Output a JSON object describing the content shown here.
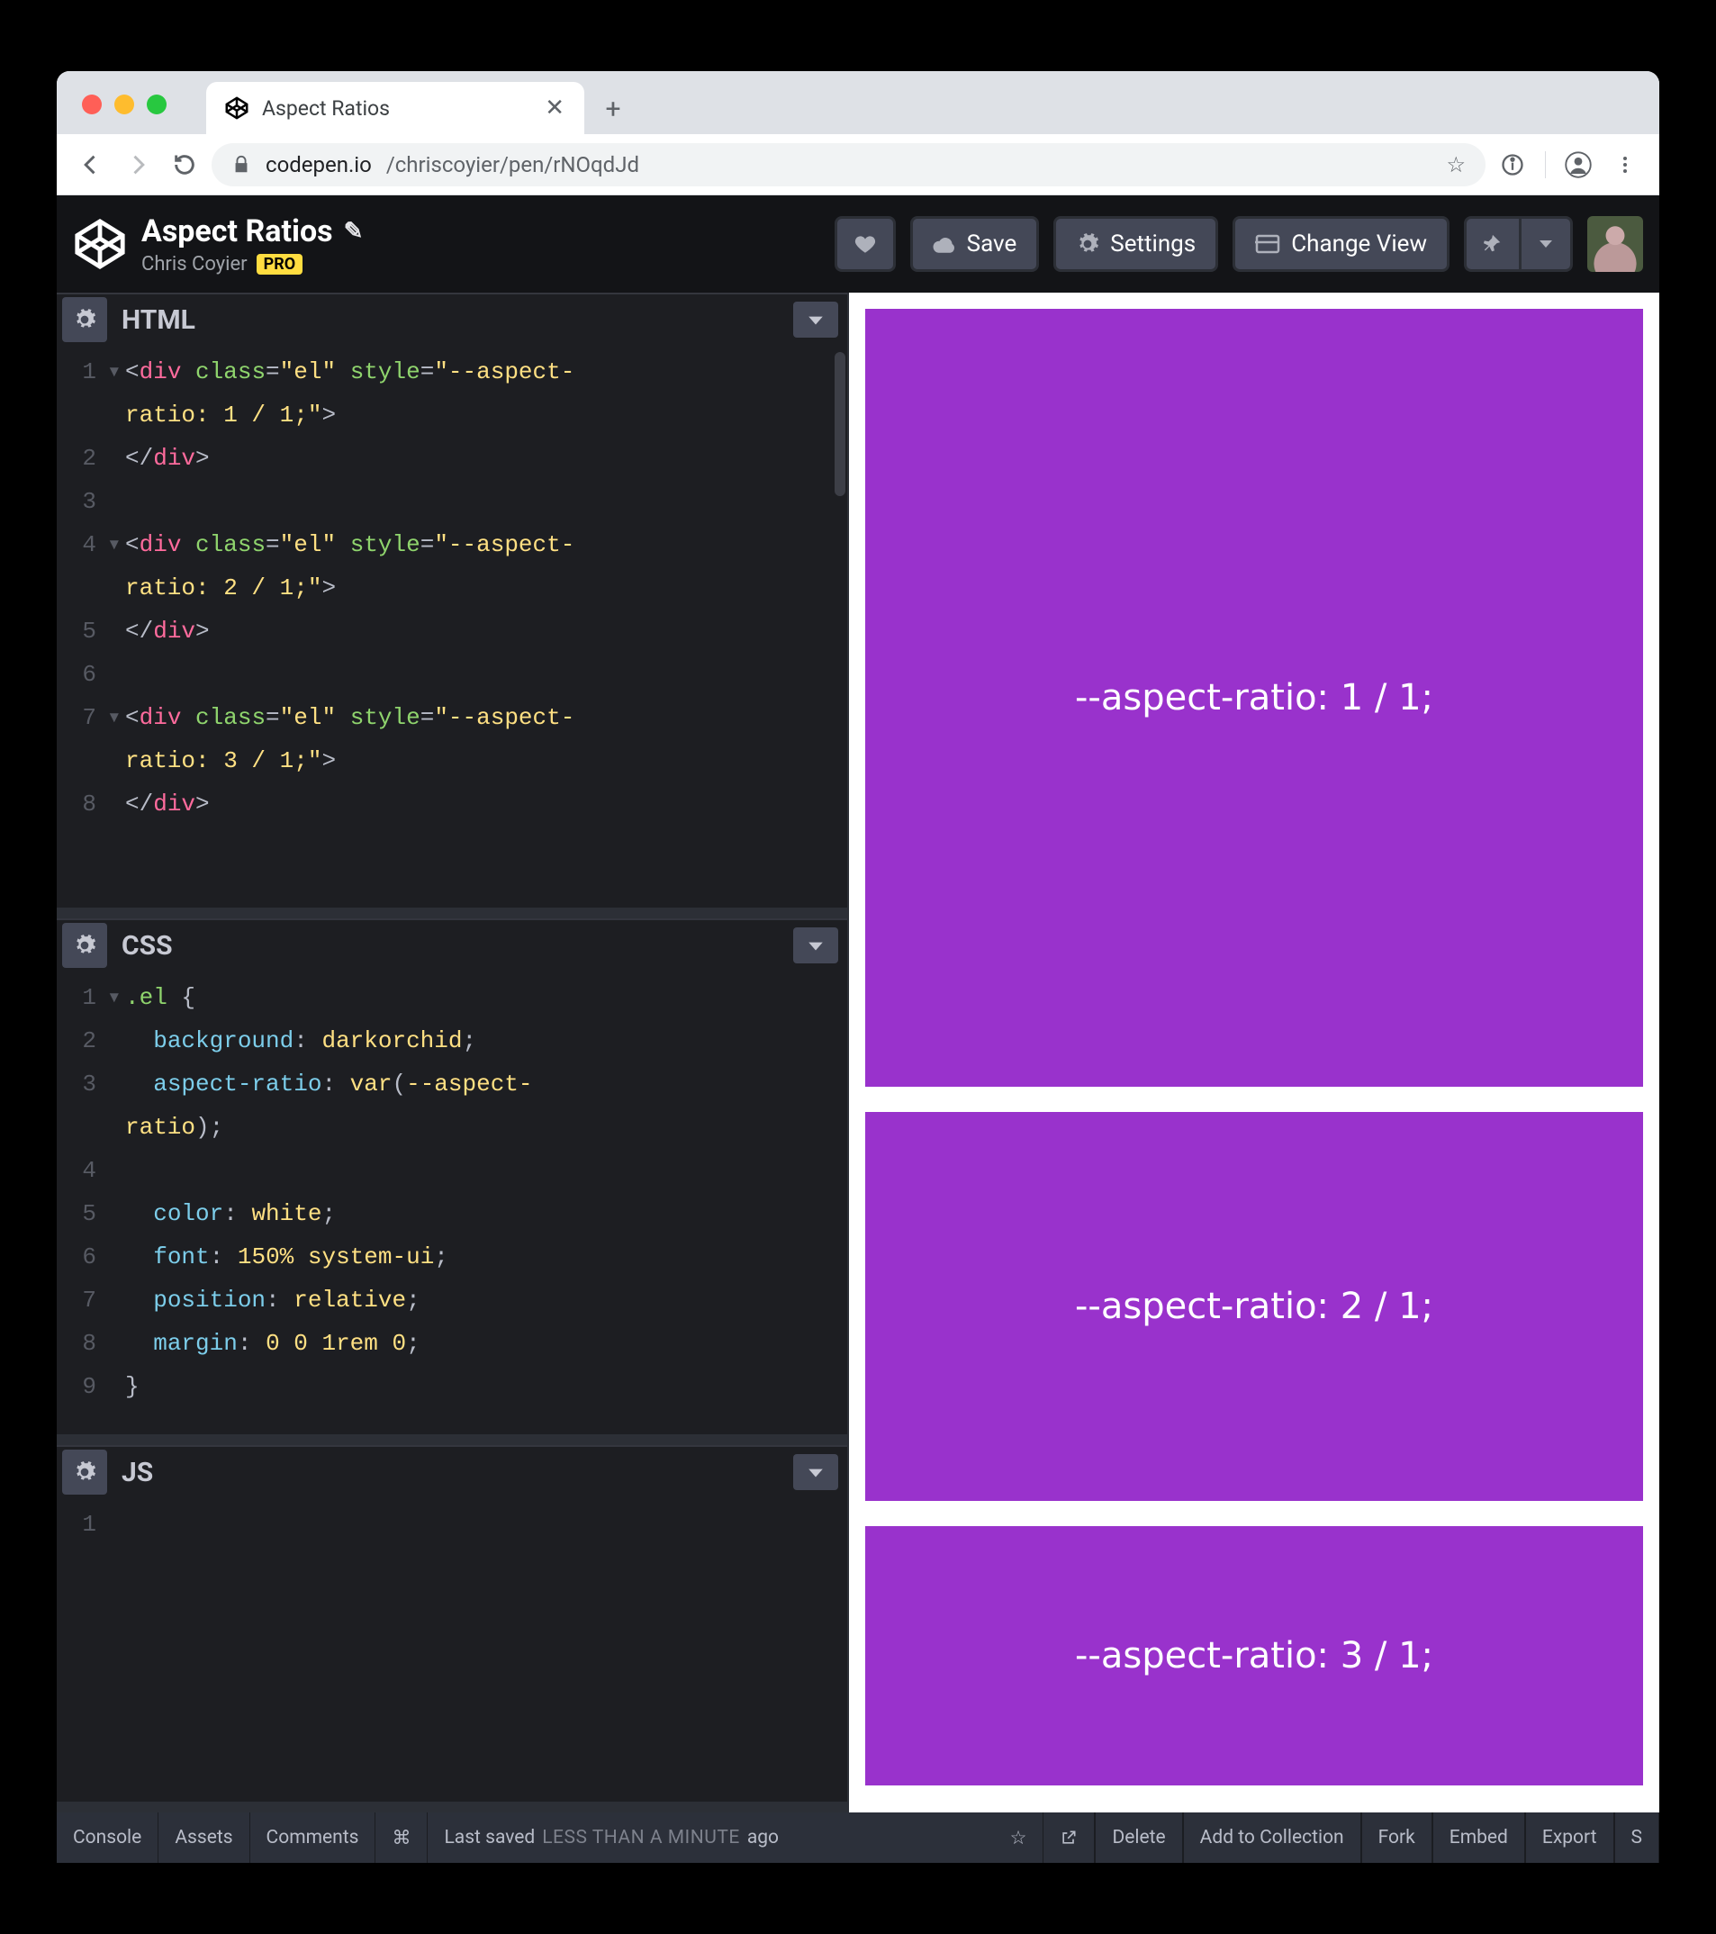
{
  "browser": {
    "tab_title": "Aspect Ratios",
    "url_host": "codepen.io",
    "url_path": "/chriscoyier/pen/rNOqdJd"
  },
  "header": {
    "pen_title": "Aspect Ratios",
    "author": "Chris Coyier",
    "pro_badge": "PRO",
    "save": "Save",
    "settings": "Settings",
    "change_view": "Change View"
  },
  "panels": {
    "html": {
      "label": "HTML"
    },
    "css": {
      "label": "CSS"
    },
    "js": {
      "label": "JS"
    }
  },
  "code_html": {
    "lines": [
      {
        "n": "1",
        "fold": "▾",
        "segs": [
          [
            "<",
            "c-punct"
          ],
          [
            "div",
            "c-tag"
          ],
          [
            " ",
            "c-plain"
          ],
          [
            "class",
            "c-attr"
          ],
          [
            "=",
            "c-punct"
          ],
          [
            "\"el\"",
            "c-str"
          ],
          [
            " ",
            "c-plain"
          ],
          [
            "style",
            "c-attr"
          ],
          [
            "=",
            "c-punct"
          ],
          [
            "\"--aspect-",
            "c-str"
          ]
        ]
      },
      {
        "n": "",
        "fold": "",
        "segs": [
          [
            "ratio: 1 / 1;\"",
            "c-str"
          ],
          [
            ">",
            "c-punct"
          ]
        ]
      },
      {
        "n": "2",
        "fold": "",
        "segs": [
          [
            "</",
            "c-punct"
          ],
          [
            "div",
            "c-tag"
          ],
          [
            ">",
            "c-punct"
          ]
        ]
      },
      {
        "n": "3",
        "fold": "",
        "segs": [
          [
            "",
            "c-plain"
          ]
        ]
      },
      {
        "n": "4",
        "fold": "▾",
        "segs": [
          [
            "<",
            "c-punct"
          ],
          [
            "div",
            "c-tag"
          ],
          [
            " ",
            "c-plain"
          ],
          [
            "class",
            "c-attr"
          ],
          [
            "=",
            "c-punct"
          ],
          [
            "\"el\"",
            "c-str"
          ],
          [
            " ",
            "c-plain"
          ],
          [
            "style",
            "c-attr"
          ],
          [
            "=",
            "c-punct"
          ],
          [
            "\"--aspect-",
            "c-str"
          ]
        ]
      },
      {
        "n": "",
        "fold": "",
        "segs": [
          [
            "ratio: 2 / 1;\"",
            "c-str"
          ],
          [
            ">",
            "c-punct"
          ]
        ]
      },
      {
        "n": "5",
        "fold": "",
        "segs": [
          [
            "</",
            "c-punct"
          ],
          [
            "div",
            "c-tag"
          ],
          [
            ">",
            "c-punct"
          ]
        ]
      },
      {
        "n": "6",
        "fold": "",
        "segs": [
          [
            "",
            "c-plain"
          ]
        ]
      },
      {
        "n": "7",
        "fold": "▾",
        "segs": [
          [
            "<",
            "c-punct"
          ],
          [
            "div",
            "c-tag"
          ],
          [
            " ",
            "c-plain"
          ],
          [
            "class",
            "c-attr"
          ],
          [
            "=",
            "c-punct"
          ],
          [
            "\"el\"",
            "c-str"
          ],
          [
            " ",
            "c-plain"
          ],
          [
            "style",
            "c-attr"
          ],
          [
            "=",
            "c-punct"
          ],
          [
            "\"--aspect-",
            "c-str"
          ]
        ]
      },
      {
        "n": "",
        "fold": "",
        "segs": [
          [
            "ratio: 3 / 1;\"",
            "c-str"
          ],
          [
            ">",
            "c-punct"
          ]
        ]
      },
      {
        "n": "8",
        "fold": "",
        "segs": [
          [
            "</",
            "c-punct"
          ],
          [
            "div",
            "c-tag"
          ],
          [
            ">",
            "c-punct"
          ]
        ]
      }
    ]
  },
  "code_css": {
    "lines": [
      {
        "n": "1",
        "fold": "▾",
        "segs": [
          [
            ".el",
            "c-sel"
          ],
          [
            " {",
            "c-punct"
          ]
        ]
      },
      {
        "n": "2",
        "fold": "",
        "segs": [
          [
            "  ",
            "c-plain"
          ],
          [
            "background",
            "c-prop"
          ],
          [
            ": ",
            "c-punct"
          ],
          [
            "darkorchid",
            "c-val"
          ],
          [
            ";",
            "c-punct"
          ]
        ]
      },
      {
        "n": "3",
        "fold": "",
        "segs": [
          [
            "  ",
            "c-plain"
          ],
          [
            "aspect-ratio",
            "c-prop"
          ],
          [
            ": ",
            "c-punct"
          ],
          [
            "var",
            "c-val"
          ],
          [
            "(",
            "c-punct"
          ],
          [
            "--aspect-",
            "c-val"
          ]
        ]
      },
      {
        "n": "",
        "fold": "",
        "segs": [
          [
            "ratio",
            "c-val"
          ],
          [
            ")",
            "c-punct"
          ],
          [
            ";",
            "c-punct"
          ]
        ]
      },
      {
        "n": "4",
        "fold": "",
        "segs": [
          [
            "",
            "c-plain"
          ]
        ]
      },
      {
        "n": "5",
        "fold": "",
        "segs": [
          [
            "  ",
            "c-plain"
          ],
          [
            "color",
            "c-prop"
          ],
          [
            ": ",
            "c-punct"
          ],
          [
            "white",
            "c-val"
          ],
          [
            ";",
            "c-punct"
          ]
        ]
      },
      {
        "n": "6",
        "fold": "",
        "segs": [
          [
            "  ",
            "c-plain"
          ],
          [
            "font",
            "c-prop"
          ],
          [
            ": ",
            "c-punct"
          ],
          [
            "150% system-ui",
            "c-val"
          ],
          [
            ";",
            "c-punct"
          ]
        ]
      },
      {
        "n": "7",
        "fold": "",
        "segs": [
          [
            "  ",
            "c-plain"
          ],
          [
            "position",
            "c-prop"
          ],
          [
            ": ",
            "c-punct"
          ],
          [
            "relative",
            "c-val"
          ],
          [
            ";",
            "c-punct"
          ]
        ]
      },
      {
        "n": "8",
        "fold": "",
        "segs": [
          [
            "  ",
            "c-plain"
          ],
          [
            "margin",
            "c-prop"
          ],
          [
            ": ",
            "c-punct"
          ],
          [
            "0 0 1rem 0",
            "c-val"
          ],
          [
            ";",
            "c-punct"
          ]
        ]
      },
      {
        "n": "9",
        "fold": "",
        "segs": [
          [
            "}",
            "c-punct"
          ]
        ]
      }
    ]
  },
  "code_js": {
    "lines": [
      {
        "n": "1",
        "fold": "",
        "segs": [
          [
            "",
            "c-plain"
          ]
        ]
      }
    ]
  },
  "preview": {
    "boxes": [
      {
        "label": "--aspect-ratio: 1 / 1;",
        "cls": "r11"
      },
      {
        "label": "--aspect-ratio: 2 / 1;",
        "cls": "r21"
      },
      {
        "label": "--aspect-ratio: 3 / 1;",
        "cls": "r31"
      }
    ]
  },
  "footer": {
    "console": "Console",
    "assets": "Assets",
    "comments": "Comments",
    "shortcut": "⌘",
    "status_prefix": "Last saved",
    "status_time": "LESS THAN A MINUTE",
    "status_suffix": "ago",
    "delete": "Delete",
    "add": "Add to Collection",
    "fork": "Fork",
    "embed": "Embed",
    "export": "Export",
    "share": "S"
  }
}
